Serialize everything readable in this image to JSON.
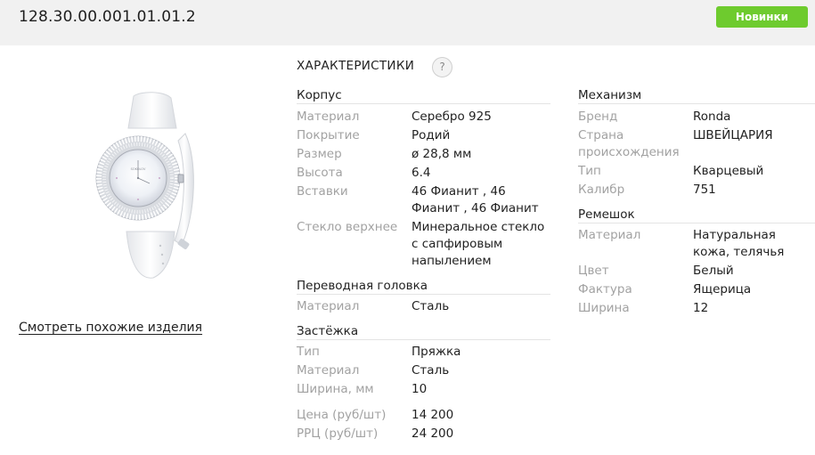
{
  "header": {
    "sku": "128.30.00.001.01.01.2",
    "badge": "Новинки"
  },
  "left": {
    "similar_link": "Смотреть похожие изделия"
  },
  "characteristics": {
    "title": "ХАРАКТЕРИСТИКИ",
    "help_glyph": "?",
    "korpus": {
      "title": "Корпус",
      "rows": [
        {
          "label": "Материал",
          "value": "Серебро 925"
        },
        {
          "label": "Покрытие",
          "value": "Родий"
        },
        {
          "label": "Размер",
          "value": "ø 28,8 мм"
        },
        {
          "label": "Высота",
          "value": "6.4"
        },
        {
          "label": "Вставки",
          "value": "46 Фианит , 46 Фианит , 46 Фианит"
        },
        {
          "label": "Стекло верхнее",
          "value": "Минеральное стекло с сапфировым напылением"
        }
      ]
    },
    "golovka": {
      "title": "Переводная головка",
      "rows": [
        {
          "label": "Материал",
          "value": "Сталь"
        }
      ]
    },
    "zastezhka": {
      "title": "Застёжка",
      "rows": [
        {
          "label": "Тип",
          "value": "Пряжка"
        },
        {
          "label": "Материал",
          "value": "Сталь"
        },
        {
          "label": "Ширина, мм",
          "value": "10"
        }
      ]
    },
    "prices": [
      {
        "label": "Цена (руб/шт)",
        "value": "14 200"
      },
      {
        "label": "РРЦ (руб/шт)",
        "value": "24 200"
      }
    ],
    "mehanizm": {
      "title": "Механизм",
      "rows": [
        {
          "label": "Бренд",
          "value": "Ronda"
        },
        {
          "label": "Страна происхождения",
          "value": "ШВЕЙЦАРИЯ"
        },
        {
          "label": "Тип",
          "value": "Кварцевый"
        },
        {
          "label": "Калибр",
          "value": "751"
        }
      ]
    },
    "remeshok": {
      "title": "Ремешок",
      "rows": [
        {
          "label": "Материал",
          "value": "Натуральная кожа, телячья"
        },
        {
          "label": "Цвет",
          "value": "Белый"
        },
        {
          "label": "Фактура",
          "value": "Ящерица"
        },
        {
          "label": "Ширина",
          "value": "12"
        }
      ]
    }
  }
}
